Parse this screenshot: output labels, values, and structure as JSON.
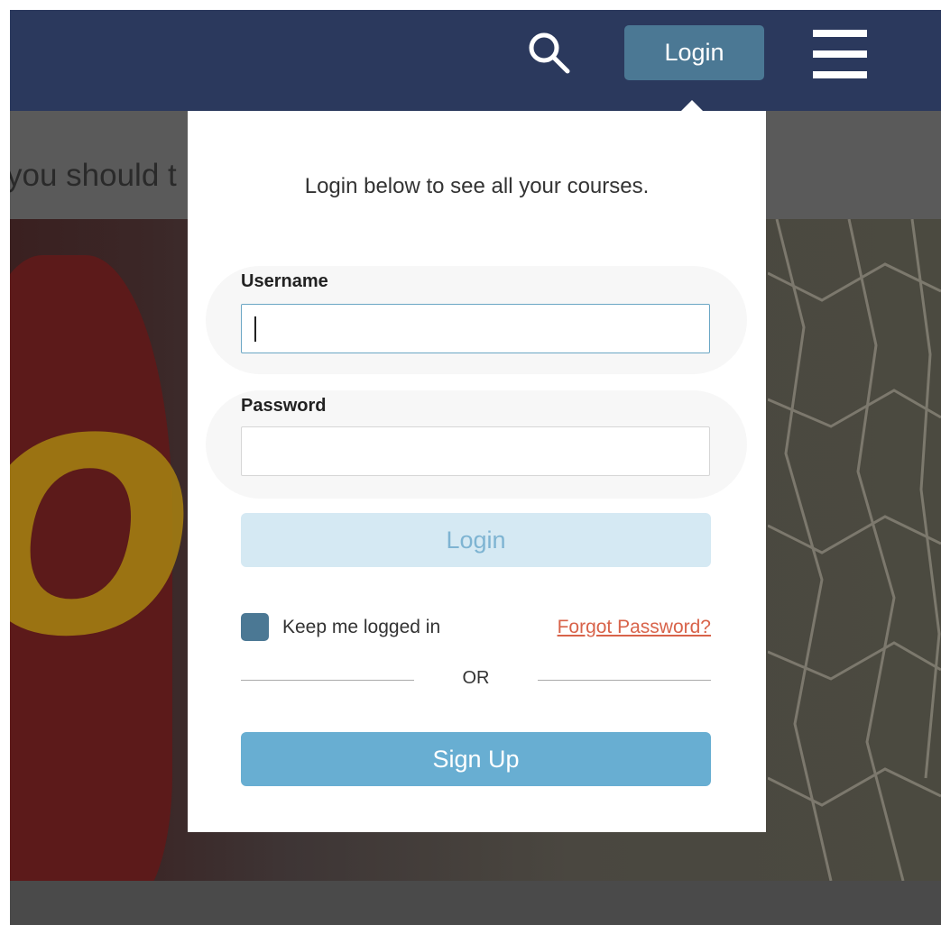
{
  "header": {
    "search_icon": "search-icon",
    "login_label": "Login",
    "menu_icon": "hamburger-menu-icon",
    "bar_color": "#2b395d",
    "accent_color": "#4b7894"
  },
  "subbar": {
    "text": "you should t"
  },
  "login_popover": {
    "intro": "Login below to see all your courses.",
    "username": {
      "label": "Username",
      "value": "",
      "placeholder": ""
    },
    "password": {
      "label": "Password",
      "value": "",
      "placeholder": ""
    },
    "submit_label": "Login",
    "keep_logged_in_label": "Keep me logged in",
    "forgot_password_label": "Forgot Password?",
    "divider_text": "OR",
    "signup_label": "Sign Up",
    "link_color": "#d8634a",
    "signup_color": "#68aed2"
  }
}
